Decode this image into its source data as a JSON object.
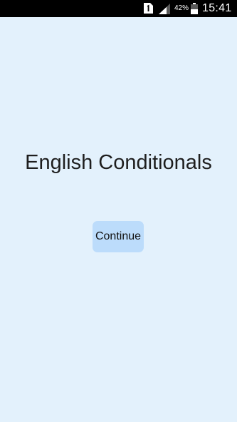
{
  "status_bar": {
    "sim_icon": "sim-card-1-icon",
    "signal_icon": "cellular-signal-icon",
    "battery_percent": "42%",
    "battery_level": 0.42,
    "battery_icon": "battery-icon",
    "time": "15:41"
  },
  "main": {
    "title": "English Conditionals",
    "continue_label": "Continue"
  },
  "colors": {
    "background": "#e3f1fc",
    "status_bar": "#000000",
    "button": "#bcdcfb",
    "title_text": "#1e1e1e"
  }
}
